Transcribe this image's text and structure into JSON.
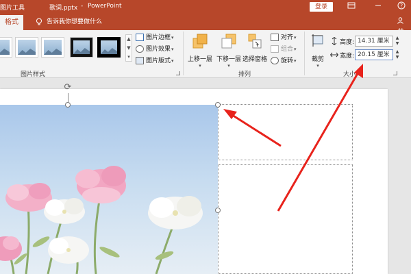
{
  "titlebar": {
    "context_label": "图片工具",
    "filename": "歌词.pptx",
    "separator": "-",
    "app_name": "PowerPoint",
    "login_label": "登录",
    "buttons": [
      "ribbon-display-icon",
      "minimize-icon",
      "help-icon"
    ]
  },
  "tabs": {
    "active_label": "格式",
    "tellme_text": "告诉我你想要做什么",
    "share_label": "共"
  },
  "ribbon": {
    "picture_styles": {
      "group_label": "图片样式",
      "thumbnails": [
        "style-1",
        "style-2",
        "style-3",
        "style-4",
        "style-5"
      ],
      "commands": [
        {
          "label": "图片边框",
          "icon": "picture-border-icon"
        },
        {
          "label": "图片效果",
          "icon": "picture-effects-icon"
        },
        {
          "label": "图片版式",
          "icon": "picture-layout-icon"
        }
      ]
    },
    "arrange": {
      "group_label": "排列",
      "bring_forward": "上移一层",
      "send_backward": "下移一层",
      "selection_pane": "选择窗格",
      "align": "对齐",
      "group": "组合",
      "rotate": "旋转"
    },
    "size": {
      "group_label": "大小",
      "crop_label": "裁剪",
      "height_label": "高度:",
      "height_value": "14.31 厘米",
      "width_label": "宽度:",
      "width_value": "20.15 厘米"
    }
  },
  "colors": {
    "accent": "#b7472a",
    "ribbon_bg": "#f3f3f3",
    "annotation_arrow": "#e8231c"
  }
}
